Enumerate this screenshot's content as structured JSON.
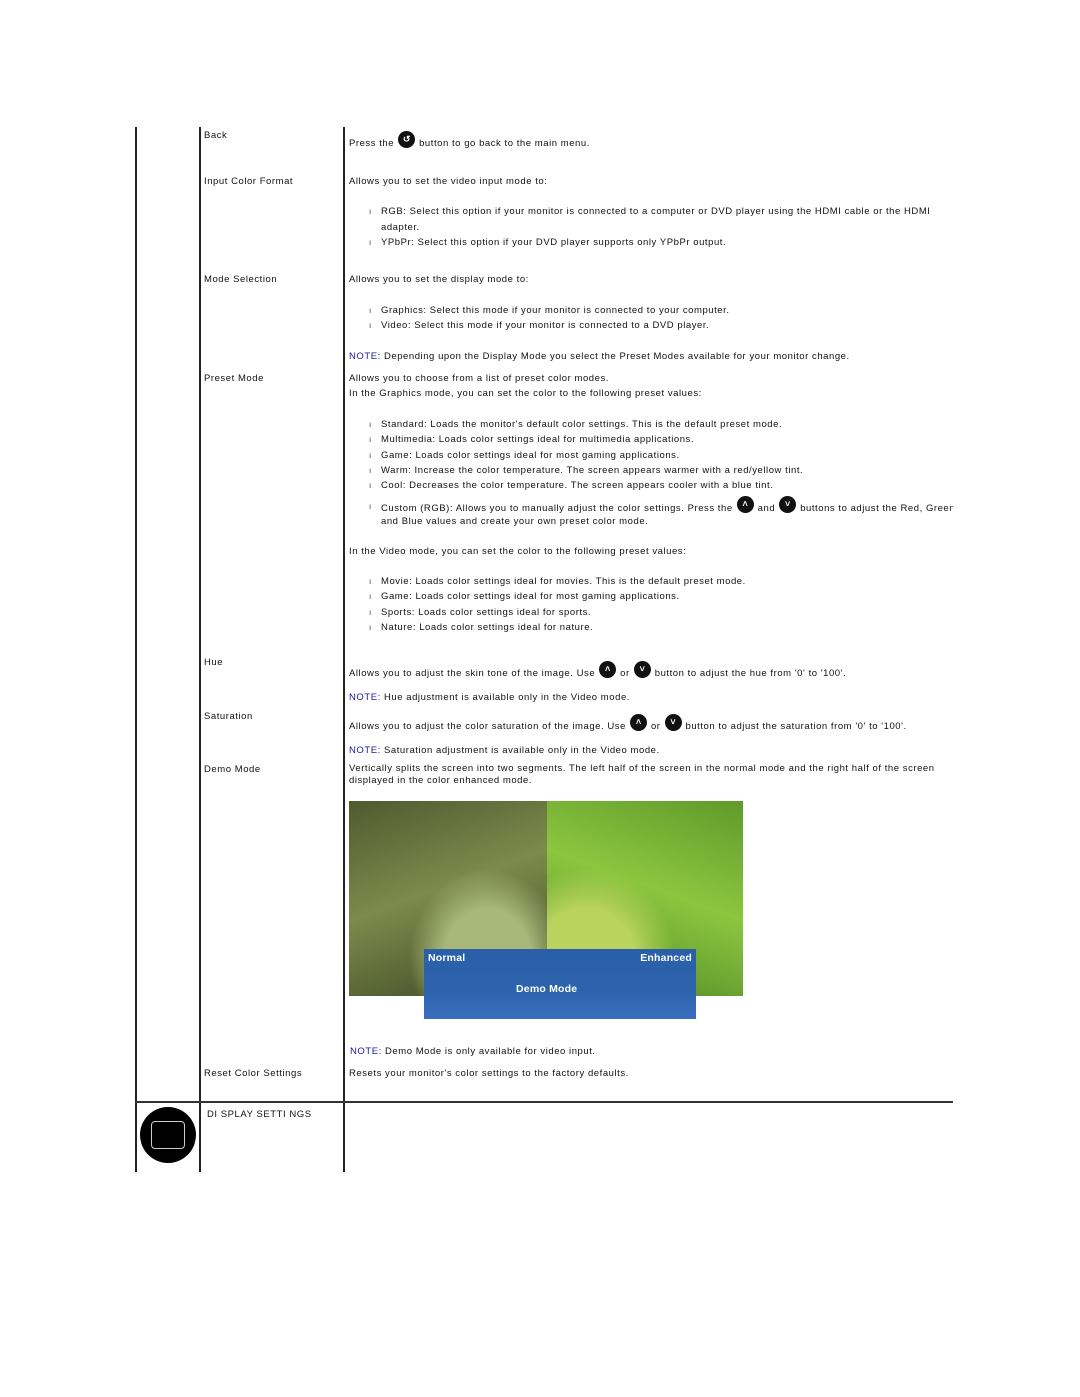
{
  "rows": {
    "back": {
      "label": "Back",
      "pre": "Press the",
      "icon": "back-icon",
      "post": "button to go back to the main menu."
    },
    "input_color": {
      "label": "Input Color Format",
      "intro": "Allows you to set the video input mode to:",
      "rgb1": "RGB: Select this option if your monitor is connected to a computer or DVD player using the HDMI cable or the HDMI",
      "rgb2": "adapter.",
      "ypbpr": "YPbPr: Select this option if your DVD player supports only YPbPr output."
    },
    "mode": {
      "label": "Mode Selection",
      "intro": "Allows you to set the display mode to:",
      "graphics": "Graphics: Select this mode if your monitor is connected to your computer.",
      "video": "Video: Select this mode if your monitor is connected to a DVD player.",
      "note_label": "NOTE:",
      "note": "Depending upon the Display Mode you select the Preset Modes available for your monitor change."
    },
    "preset": {
      "label": "Preset Mode",
      "intro1": "Allows you to choose from a list of preset color modes.",
      "intro2": "In the Graphics mode, you can set the color to the following preset values:",
      "g": [
        "Standard: Loads the monitor's default color settings. This is the default preset mode.",
        "Multimedia: Loads color settings ideal for multimedia applications.",
        "Game: Loads color settings ideal for most gaming applications.",
        "Warm: Increase the color temperature. The screen appears warmer with a red/yellow tint.",
        "Cool: Decreases the color temperature. The screen appears cooler with a blue tint."
      ],
      "custom_a": "Custom (RGB): Allows you to manually adjust the color settings. Press the",
      "custom_and": "and",
      "custom_b": "buttons to adjust the Red, Green,",
      "custom2": "and Blue values and create your own preset color mode.",
      "video_intro": "In the Video mode, you can set the color to the following preset values:",
      "v": [
        "Movie: Loads color settings ideal for movies. This is the default preset mode.",
        "Game: Loads color settings ideal for most gaming applications.",
        "Sports: Loads color settings ideal for sports.",
        "Nature: Loads color settings ideal for nature."
      ]
    },
    "hue": {
      "label": "Hue",
      "pre": "Allows you to adjust the skin tone of the image. Use",
      "or": "or",
      "post": "button to adjust the hue from '0' to '100'.",
      "note_label": "NOTE:",
      "note": "Hue adjustment is available only in the Video mode."
    },
    "saturation": {
      "label": "Saturation",
      "pre": "Allows you to adjust the color saturation of the image. Use",
      "or": "or",
      "post": "button to adjust the saturation from '0' to '100'.",
      "note_label": "NOTE:",
      "note": "Saturation adjustment is available only in the Video mode."
    },
    "demo": {
      "label": "Demo Mode",
      "desc1": "Vertically splits the screen into two segments. The left half of the screen in the normal mode and the right half of the screen",
      "desc2": "displayed in the color enhanced mode.",
      "img_normal": "Normal",
      "img_enhanced": "Enhanced",
      "img_title": "Demo  Mode",
      "note_label": "NOTE:",
      "note": "Demo Mode is only available for video input."
    },
    "reset": {
      "label": "Reset Color Settings",
      "desc": "Resets your monitor's color settings to the factory defaults."
    }
  },
  "section": {
    "label": "DI SPLAY SETTI NGS",
    "icon": "display-settings-icon"
  },
  "bullet": "ı",
  "colors": {
    "note": "#1a1a9c",
    "overlay": "#2d63ad"
  }
}
